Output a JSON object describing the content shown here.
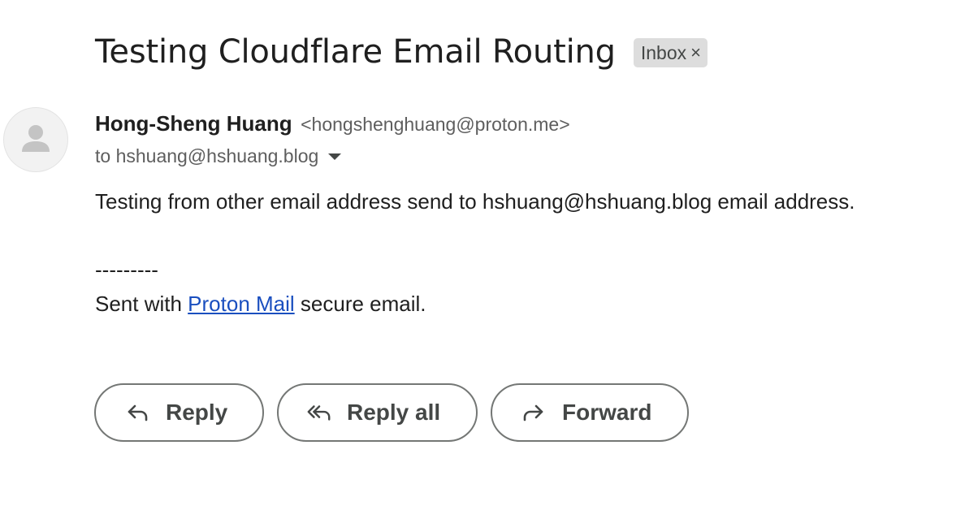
{
  "email": {
    "subject": "Testing Cloudflare Email Routing",
    "label": {
      "text": "Inbox",
      "close_glyph": "×"
    },
    "sender": {
      "name": "Hong-Sheng Huang",
      "email": "<hongshenghuang@proton.me>"
    },
    "recipient_line": "to hshuang@hshuang.blog",
    "body": {
      "main": "Testing from other email address send to hshuang@hshuang.blog email address.",
      "separator": "---------",
      "footer_prefix": "Sent with ",
      "footer_link": "Proton Mail",
      "footer_suffix": " secure email."
    }
  },
  "actions": {
    "reply": "Reply",
    "reply_all": "Reply all",
    "forward": "Forward"
  },
  "icons": {
    "avatar": "person-avatar-icon",
    "recipient_caret": "caret-down-icon",
    "reply": "reply-arrow-icon",
    "reply_all": "reply-all-arrow-icon",
    "forward": "forward-arrow-icon"
  },
  "colors": {
    "link": "#1a4fbf",
    "chip_background": "#dddddd",
    "button_border": "#747775",
    "secondary_text": "#5e5e5e"
  }
}
